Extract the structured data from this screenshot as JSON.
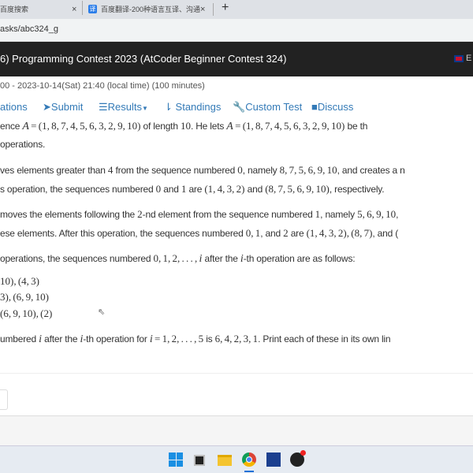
{
  "browser": {
    "tabs": [
      {
        "title": "百度搜索"
      },
      {
        "title": "百度翻译-200种语言互译、沟通"
      }
    ],
    "new_tab": "+",
    "close": "×",
    "tab_icon": "译",
    "address": "asks/abc324_g"
  },
  "header": {
    "title": "6) Programming Contest 2023 (AtCoder Beginner Contest 324)",
    "lang": "E"
  },
  "contest_time": "00 - 2023-10-14(Sat) 21:40 (local time) (100 minutes)",
  "nav": [
    {
      "label": "ations",
      "icon": ""
    },
    {
      "label": "Submit",
      "icon": "paper-plane-icon"
    },
    {
      "label": "Results",
      "icon": "list-icon"
    },
    {
      "label": "Standings",
      "icon": "sort-icon"
    },
    {
      "label": "Custom Test",
      "icon": "wrench-icon"
    },
    {
      "label": "Discuss",
      "icon": "comment-icon"
    }
  ],
  "lines": [
    [
      [
        "t",
        "ence "
      ],
      [
        "mi",
        "A"
      ],
      [
        "m",
        " = (1, 8, 7, 4, 5, 6, 3, 2, 9, 10)"
      ],
      [
        "t",
        " of length "
      ],
      [
        "m",
        "10"
      ],
      [
        "t",
        ". He lets "
      ],
      [
        "mi",
        "A"
      ],
      [
        "m",
        " = (1, 8, 7, 4, 5, 6, 3, 2, 9, 10)"
      ],
      [
        "t",
        " be th"
      ]
    ],
    [
      [
        "t",
        "operations."
      ]
    ],
    [
      [
        "t",
        "ves elements greater than "
      ],
      [
        "m",
        "4"
      ],
      [
        "t",
        " from the sequence numbered "
      ],
      [
        "m",
        "0"
      ],
      [
        "t",
        ", namely "
      ],
      [
        "m",
        "8, 7, 5, 6, 9, 10"
      ],
      [
        "t",
        ", and creates a n"
      ]
    ],
    [
      [
        "t",
        "s operation, the sequences numbered "
      ],
      [
        "m",
        "0"
      ],
      [
        "t",
        " and "
      ],
      [
        "m",
        "1"
      ],
      [
        "t",
        " are "
      ],
      [
        "m",
        "(1, 4, 3, 2)"
      ],
      [
        "t",
        " and "
      ],
      [
        "m",
        "(8, 7, 5, 6, 9, 10)"
      ],
      [
        "t",
        ", respectively."
      ]
    ],
    [
      [
        "t",
        "moves the elements following the "
      ],
      [
        "m",
        "2"
      ],
      [
        "t",
        "-nd element from the sequence numbered "
      ],
      [
        "m",
        "1"
      ],
      [
        "t",
        ", namely "
      ],
      [
        "m",
        "5, 6, 9, 10"
      ],
      [
        "t",
        ","
      ]
    ],
    [
      [
        "t",
        "ese elements. After this operation, the sequences numbered "
      ],
      [
        "m",
        "0, 1"
      ],
      [
        "t",
        ", and "
      ],
      [
        "m",
        "2"
      ],
      [
        "t",
        " are "
      ],
      [
        "m",
        "(1, 4, 3, 2), (8, 7)"
      ],
      [
        "t",
        ", and ("
      ]
    ],
    [
      [
        "t",
        "operations, the sequences numbered "
      ],
      [
        "m",
        "0, 1, 2, . . . , "
      ],
      [
        "mi",
        "i"
      ],
      [
        "t",
        " after the "
      ],
      [
        "mi",
        "i"
      ],
      [
        "t",
        "-th operation are as follows:"
      ]
    ],
    [
      [
        "m",
        "10), (4, 3)"
      ]
    ],
    [
      [
        "m",
        "3), (6, 9, 10)"
      ]
    ],
    [
      [
        "m",
        " (6, 9, 10), (2)"
      ]
    ],
    [
      [
        "t",
        "umbered "
      ],
      [
        "mi",
        "i"
      ],
      [
        "t",
        " after the "
      ],
      [
        "mi",
        "i"
      ],
      [
        "t",
        "-th operation for "
      ],
      [
        "mi",
        "i"
      ],
      [
        "m",
        " = 1, 2, . . . , 5"
      ],
      [
        "t",
        " is "
      ],
      [
        "m",
        "6, 4, 2, 3, 1"
      ],
      [
        "t",
        ". Print each of these in its own lin"
      ]
    ]
  ],
  "taskbar": [
    "start-icon",
    "task-view-icon",
    "file-explorer-icon",
    "chrome-icon",
    "devcpp-icon",
    "obs-icon"
  ]
}
